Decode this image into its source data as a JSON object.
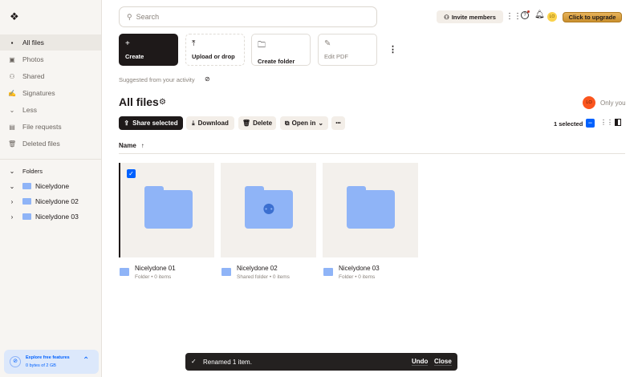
{
  "sidebar": {
    "nav": [
      {
        "label": "All files",
        "icon": "all-files-icon"
      },
      {
        "label": "Photos",
        "icon": "photos-icon"
      },
      {
        "label": "Shared",
        "icon": "shared-icon"
      },
      {
        "label": "Signatures",
        "icon": "signatures-icon"
      },
      {
        "label": "Less",
        "icon": "chevron-down-icon"
      },
      {
        "label": "File requests",
        "icon": "file-requests-icon"
      },
      {
        "label": "Deleted files",
        "icon": "trash-icon"
      }
    ],
    "folders_label": "Folders",
    "folders": [
      "Nicelydone",
      "Nicelydone 02",
      "Nicelydone 03"
    ],
    "explore": {
      "title": "Explore free features",
      "storage": "0 bytes of 2 GB"
    }
  },
  "header": {
    "search_placeholder": "Search",
    "invite": "Invite members",
    "avatar": "LO",
    "upgrade": "Click to upgrade"
  },
  "tiles": [
    {
      "label": "Create",
      "icon": "+"
    },
    {
      "label": "Upload or drop",
      "icon": "⤒"
    },
    {
      "label": "Create folder",
      "icon": "🗀"
    },
    {
      "label": "Edit PDF",
      "icon": "✎"
    }
  ],
  "suggested": "Suggested from your activity",
  "page_title": "All files",
  "owner": {
    "avatar": "LO",
    "label": "Only you"
  },
  "actions": {
    "share": "Share selected",
    "download": "Download",
    "delete": "Delete",
    "open_in": "Open in",
    "more": "•••"
  },
  "selected_count": "1 selected",
  "column": "Name",
  "files": [
    {
      "name": "Nicelydone 01",
      "meta": "Folder • 0 items",
      "selected": true,
      "shared": false
    },
    {
      "name": "Nicelydone 02",
      "meta": "Shared folder • 0 items",
      "selected": false,
      "shared": true
    },
    {
      "name": "Nicelydone 03",
      "meta": "Folder • 0 items",
      "selected": false,
      "shared": false
    }
  ],
  "toast": {
    "message": "Renamed 1 item.",
    "undo": "Undo",
    "close": "Close"
  },
  "colors": {
    "accent": "#0061fe",
    "upgrade": "#d9a441",
    "avatar_orange": "#fa551e",
    "avatar_yellow": "#fad24b"
  }
}
